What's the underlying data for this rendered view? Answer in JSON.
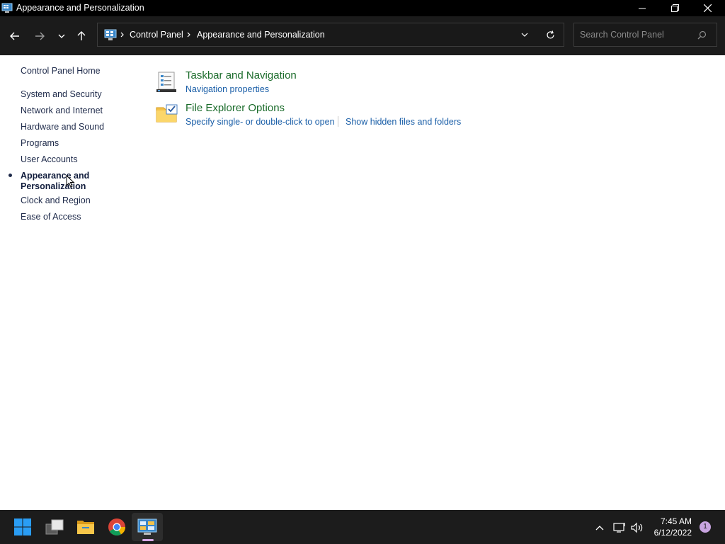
{
  "window": {
    "title": "Appearance and Personalization",
    "controls": [
      "minimize",
      "maximize",
      "close"
    ]
  },
  "address_bar": {
    "breadcrumb": [
      "Control Panel",
      "Appearance and Personalization"
    ]
  },
  "search": {
    "placeholder": "Search Control Panel",
    "value": ""
  },
  "left_nav": {
    "home": "Control Panel Home",
    "items": [
      "System and Security",
      "Network and Internet",
      "Hardware and Sound",
      "Programs",
      "User Accounts",
      "Appearance and Personalization",
      "Clock and Region",
      "Ease of Access"
    ],
    "active_index": 5
  },
  "content": {
    "items": [
      {
        "title": "Taskbar and Navigation",
        "icon": "taskbar-icon",
        "links": [
          "Navigation properties"
        ]
      },
      {
        "title": "File Explorer Options",
        "icon": "folder-options-icon",
        "links": [
          "Specify single- or double-click to open",
          "Show hidden files and folders"
        ]
      }
    ]
  },
  "taskbar": {
    "apps": [
      "start-icon",
      "task-view-icon",
      "file-explorer-icon",
      "chrome-icon",
      "control-panel-icon"
    ],
    "time": "7:45 AM",
    "date": "6/12/2022",
    "notification_count": "1"
  },
  "colors": {
    "title_green": "#1a6b2a",
    "link_blue": "#1b5fa8",
    "nav_text": "#1e2a4a",
    "accent": "#c8a4e0"
  }
}
